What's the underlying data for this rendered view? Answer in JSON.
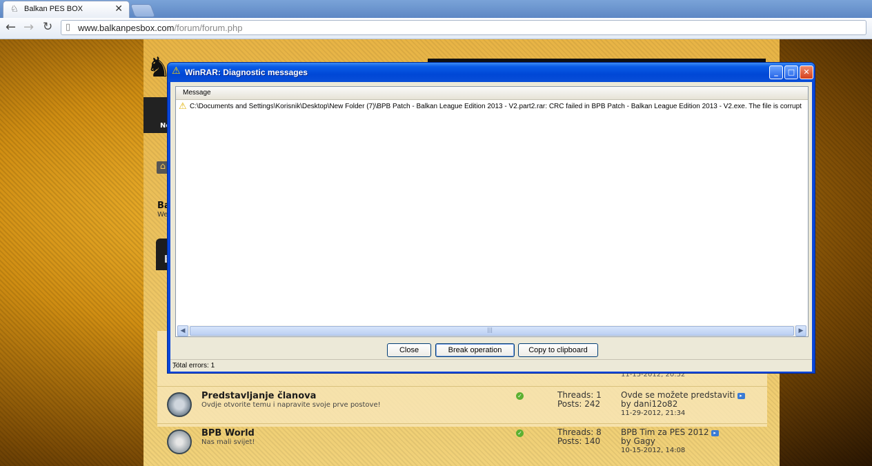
{
  "browser": {
    "tab_title": "Balkan PES BOX",
    "url_host": "www.balkanpesbox.com",
    "url_path": "/forum/forum.php"
  },
  "page": {
    "nav_fragment": "Ne",
    "heading_fragment": "Ba",
    "subheading_fragment": "We",
    "tab_fragment": "S",
    "cut_date": "11-15-2012, 20:52"
  },
  "forums": [
    {
      "name": "Predstavljanje članova",
      "description": "Ovdje otvorite temu i napravite svoje prve postove!",
      "threads": "Threads: 1",
      "posts": "Posts: 242",
      "last_title": "Ovde se možete predstaviti",
      "last_by": "by dani12o82",
      "last_date": "11-29-2012, 21:34"
    },
    {
      "name": "BPB World",
      "description": "Nas mali svijet!",
      "threads": "Threads: 8",
      "posts": "Posts: 140",
      "last_title": "BPB Tim za PES 2012",
      "last_by": "by Gagy",
      "last_date": "10-15-2012, 14:08"
    }
  ],
  "dialog": {
    "title": "WinRAR: Diagnostic messages",
    "column_header": "Message",
    "messages": [
      "C:\\Documents and Settings\\Korisnik\\Desktop\\New Folder (7)\\BPB Patch - Balkan League Edition 2013 - V2.part2.rar: CRC failed in BPB Patch - Balkan League Edition 2013 - V2.exe. The file is corrupt"
    ],
    "buttons": {
      "close": "Close",
      "break": "Break operation",
      "copy": "Copy to clipboard"
    },
    "status": "Total errors: 1"
  },
  "icons": {
    "tab_favicon": "running-man-icon",
    "warning": "warning-icon",
    "page": "page-icon"
  },
  "colors": {
    "titlebar": "#0047d6",
    "dialog_face": "#ece9d8",
    "accent_gold": "#e8b445"
  }
}
